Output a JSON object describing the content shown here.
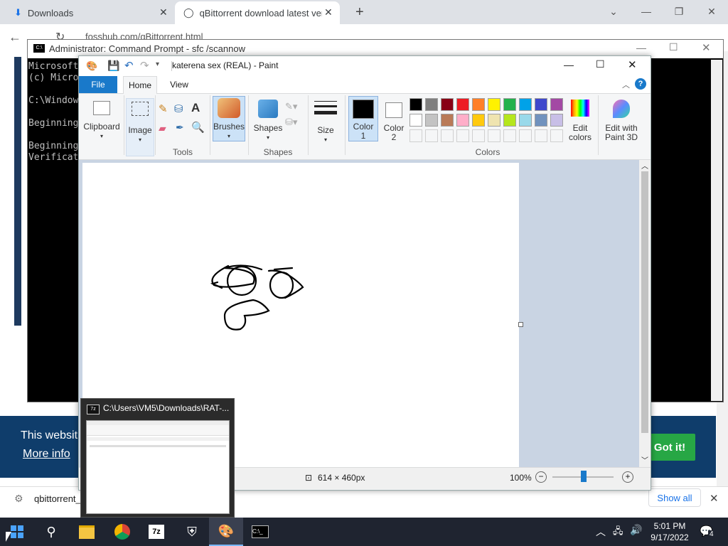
{
  "browser": {
    "tabs": [
      {
        "label": "Downloads"
      },
      {
        "label": "qBittorrent download latest versi"
      }
    ],
    "address": "fosshub.com/qBittorrent.html",
    "cookie_text": "This websit",
    "cookie_more": "More info",
    "cookie_button": "Got it!",
    "download_item": "qbittorrent_",
    "show_all": "Show all"
  },
  "cmd": {
    "title": "Administrator: Command Prompt - sfc  /scannow",
    "lines": [
      "Microsoft",
      "(c) Micro",
      "",
      "C:\\Window",
      "",
      "Beginning",
      "",
      "Beginning",
      "Verificat"
    ]
  },
  "paint": {
    "title": "katerena sex (REAL) - Paint",
    "tabs": {
      "file": "File",
      "home": "Home",
      "view": "View"
    },
    "ribbon": {
      "clipboard": "Clipboard",
      "image": "Image",
      "tools": "Tools",
      "brushes": "Brushes",
      "shapes": "Shapes",
      "shapes_group": "Shapes",
      "size": "Size",
      "color1": "Color\n1",
      "color2": "Color\n2",
      "colors_group": "Colors",
      "edit_colors": "Edit\ncolors",
      "edit_paint3d": "Edit with\nPaint 3D"
    },
    "palette_row1": [
      "#000000",
      "#7f7f7f",
      "#880015",
      "#ed1c24",
      "#ff7f27",
      "#fff200",
      "#22b14c",
      "#00a2e8",
      "#3f48cc",
      "#a349a4"
    ],
    "palette_row2": [
      "#ffffff",
      "#c3c3c3",
      "#b97a57",
      "#ffaec9",
      "#ffc90e",
      "#efe4b0",
      "#b5e61d",
      "#99d9ea",
      "#7092be",
      "#c8bfe7"
    ],
    "status_size": "614 × 460px",
    "zoom": "100%"
  },
  "preview": {
    "title": "C:\\Users\\VM5\\Downloads\\RAT-..."
  },
  "taskbar": {
    "time": "5:01 PM",
    "date": "9/17/2022",
    "notif_count": "4"
  }
}
